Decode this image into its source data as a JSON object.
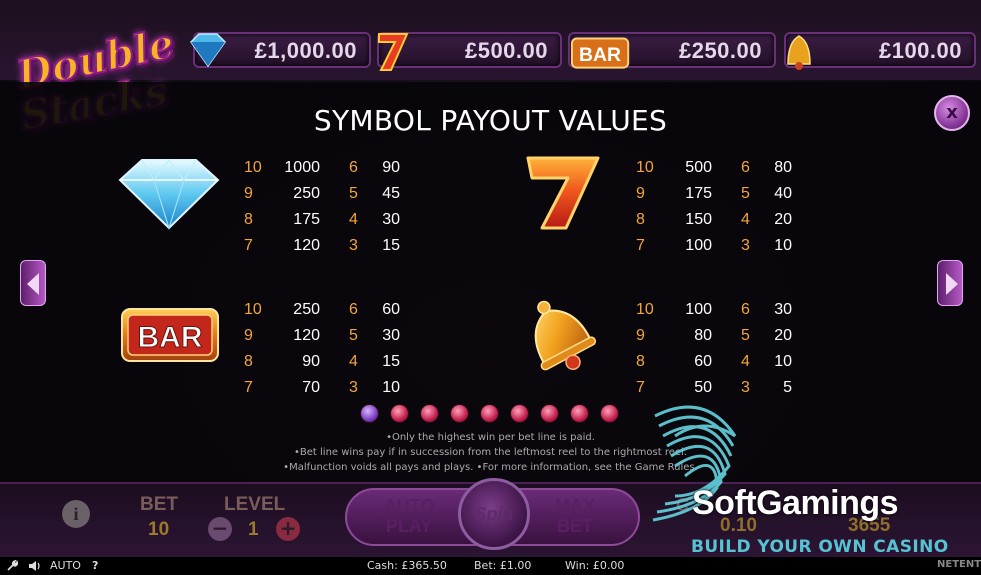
{
  "jackpots": [
    {
      "icon": "diamond-icon",
      "value": "£1,000.00"
    },
    {
      "icon": "seven-icon",
      "value": "£500.00"
    },
    {
      "icon": "bar-icon",
      "value": "£250.00"
    },
    {
      "icon": "bell-icon",
      "value": "£100.00"
    }
  ],
  "logo": {
    "line1": "Double",
    "line2": "Stacks"
  },
  "panel": {
    "title": "SYMBOL PAYOUT VALUES",
    "close_label": "x",
    "symbols": [
      {
        "name": "diamond",
        "icon": "diamond-icon",
        "rows": [
          [
            "10",
            "1000",
            "6",
            "90"
          ],
          [
            "9",
            "250",
            "5",
            "45"
          ],
          [
            "8",
            "175",
            "4",
            "30"
          ],
          [
            "7",
            "120",
            "3",
            "15"
          ]
        ]
      },
      {
        "name": "seven",
        "icon": "seven-icon",
        "rows": [
          [
            "10",
            "500",
            "6",
            "80"
          ],
          [
            "9",
            "175",
            "5",
            "40"
          ],
          [
            "8",
            "150",
            "4",
            "20"
          ],
          [
            "7",
            "100",
            "3",
            "10"
          ]
        ]
      },
      {
        "name": "bar",
        "icon": "bar-icon",
        "label": "BAR",
        "rows": [
          [
            "10",
            "250",
            "6",
            "60"
          ],
          [
            "9",
            "120",
            "5",
            "30"
          ],
          [
            "8",
            "90",
            "4",
            "15"
          ],
          [
            "7",
            "70",
            "3",
            "10"
          ]
        ]
      },
      {
        "name": "bell",
        "icon": "bell-icon",
        "rows": [
          [
            "10",
            "100",
            "6",
            "30"
          ],
          [
            "9",
            "80",
            "5",
            "20"
          ],
          [
            "8",
            "60",
            "4",
            "10"
          ],
          [
            "7",
            "50",
            "3",
            "5"
          ]
        ]
      }
    ],
    "pages": {
      "total": 9,
      "current": 1
    },
    "notes": [
      "•Only the highest win per bet line is paid.",
      "•Bet line wins pay if in succession from the leftmost reel to the rightmost reel.",
      "•Malfunction voids all pays and plays.   •For more information, see the Game Rules."
    ]
  },
  "controls": {
    "info_label": "i",
    "bet_label": "BET",
    "bet_value": "10",
    "level_label": "LEVEL",
    "level_value": "1",
    "minus_label": "−",
    "plus_label": "+",
    "auto_play_label": "AUTO\nPLAY",
    "spin_label": "Spin",
    "max_bet_label": "MAX\nBET",
    "coin_label": "C",
    "coin_value": "0.10",
    "credit_value": "3655"
  },
  "status_bar": {
    "auto_label": "AUTO",
    "help_label": "?",
    "cash": "Cash: £365.50",
    "bet": "Bet: £1.00",
    "win": "Win: £0.00",
    "brand": "NETENT"
  },
  "watermark": {
    "title": "SoftGamings",
    "subtitle": "BUILD YOUR OWN CASINO"
  },
  "colors": {
    "accent": "#8a3a9c",
    "multiplier": "#f2a53b",
    "watermark_sub": "#56c3d3"
  }
}
